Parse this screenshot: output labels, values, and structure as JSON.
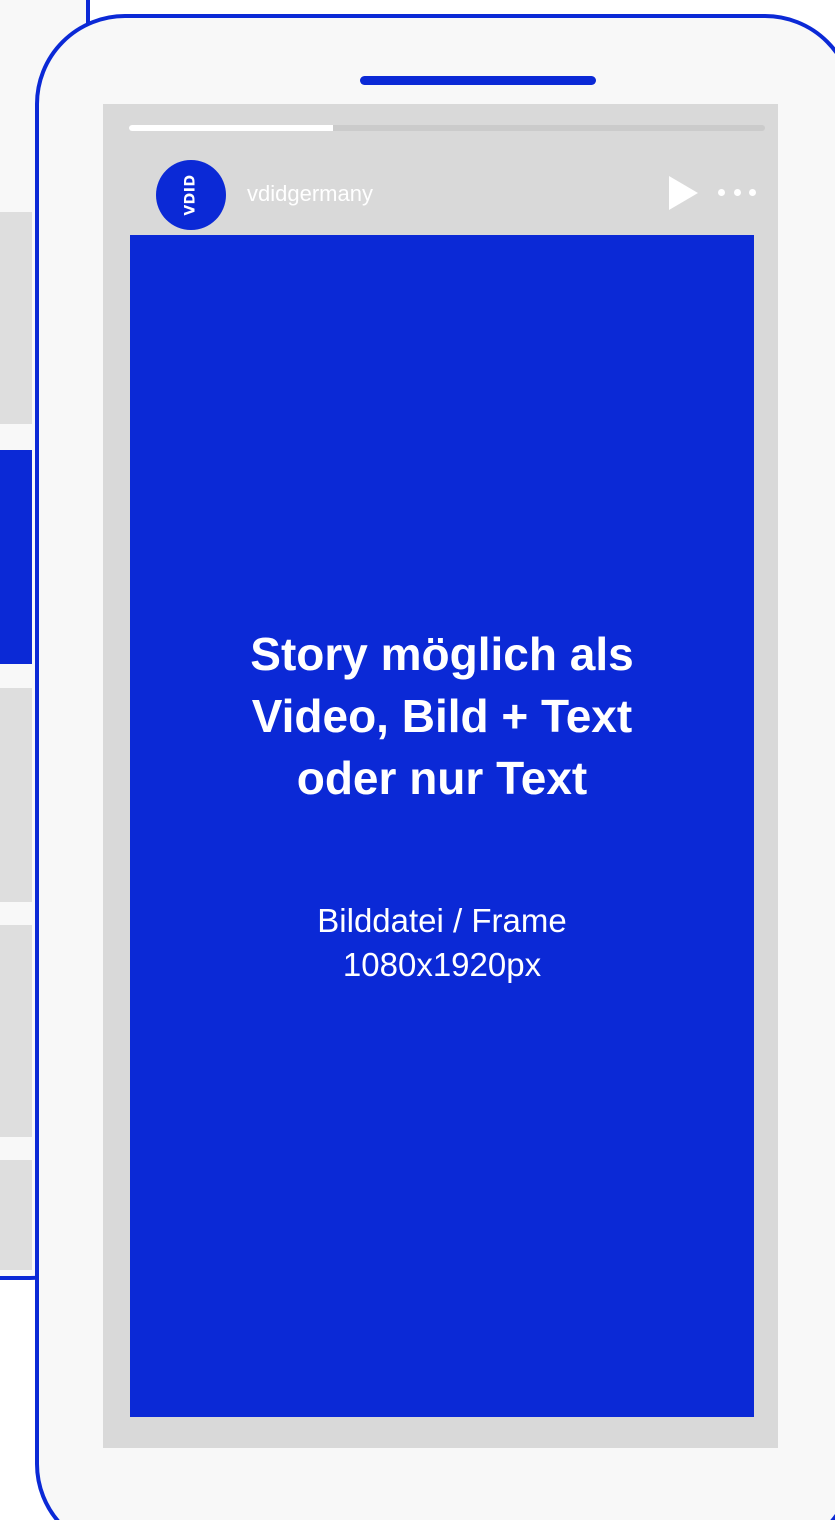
{
  "header": {
    "username": "vdidgermany",
    "avatar_text": "VDID"
  },
  "progress": {
    "fraction": 0.32
  },
  "story": {
    "headline_lines": [
      "Story möglich als",
      "Video, Bild + Text",
      "oder nur Text"
    ],
    "subtext_lines": [
      "Bilddatei / Frame",
      "1080x1920px"
    ]
  },
  "icons": {
    "play": "play-icon",
    "more": "more-options-icon"
  },
  "colors": {
    "brand_blue": "#0b29d6",
    "screen_gray": "#d9d9d9",
    "phone_bg": "#f8f8f8"
  }
}
